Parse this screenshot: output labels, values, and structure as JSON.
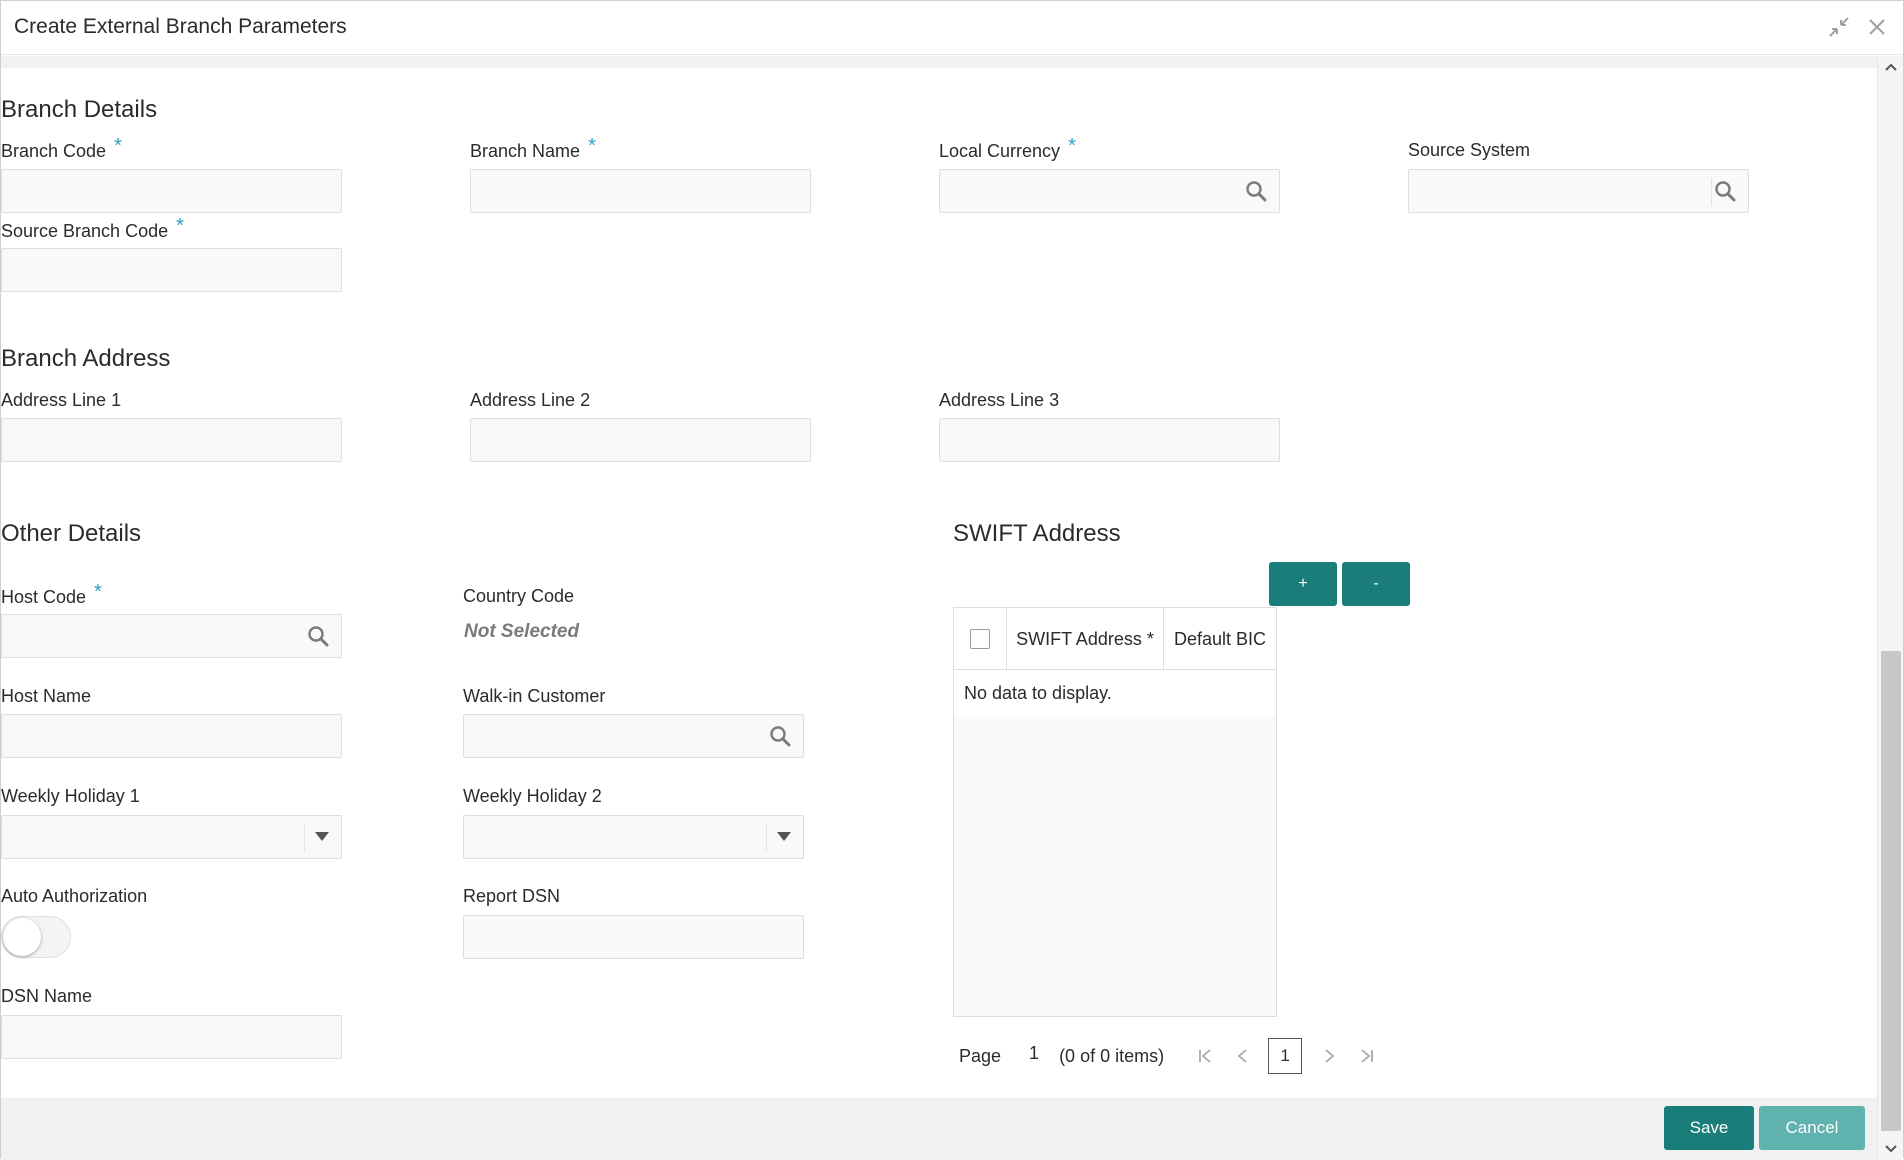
{
  "window": {
    "title": "Create External Branch Parameters",
    "icons": [
      "minimize-icon",
      "close-icon"
    ]
  },
  "branch_details": {
    "title": "Branch Details",
    "branch_code_label": "Branch Code",
    "branch_name_label": "Branch Name",
    "local_currency_label": "Local Currency",
    "source_system_label": "Source System",
    "source_branch_code_label": "Source Branch Code",
    "required_mark": "*"
  },
  "branch_address": {
    "title": "Branch Address",
    "line1_label": "Address Line 1",
    "line2_label": "Address Line 2",
    "line3_label": "Address Line 3"
  },
  "other_details": {
    "title": "Other Details",
    "host_code_label": "Host Code",
    "country_code_label": "Country Code",
    "country_code_value": "Not Selected",
    "host_name_label": "Host Name",
    "walkin_customer_label": "Walk-in Customer",
    "weekly_holiday1_label": "Weekly Holiday 1",
    "weekly_holiday2_label": "Weekly Holiday 2",
    "auto_authorization_label": "Auto Authorization",
    "auto_authorization_on": false,
    "report_dsn_label": "Report DSN",
    "dsn_name_label": "DSN Name"
  },
  "swift": {
    "title": "SWIFT Address",
    "add_label": "+",
    "remove_label": "-",
    "columns": [
      "SWIFT Address *",
      "Default BIC"
    ],
    "empty_text": "No data to display.",
    "pager": {
      "page_label": "Page",
      "page_value": "1",
      "items_text": "(0 of 0 items)",
      "current_page": "1"
    }
  },
  "footer": {
    "save_label": "Save",
    "cancel_label": "Cancel"
  },
  "colors": {
    "primary": "#1b7d7a",
    "cancel": "#5fb2ad",
    "required": "#2aa3c2"
  }
}
